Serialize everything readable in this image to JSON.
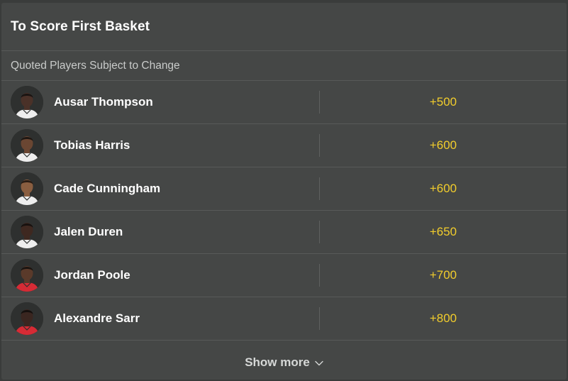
{
  "market": {
    "title": "To Score First Basket",
    "subtitle": "Quoted Players Subject to Change"
  },
  "players": [
    {
      "name": "Ausar Thompson",
      "odds": "+500",
      "skin": "#4a3128",
      "jersey": "#eeeeee",
      "hair": "#1a1412"
    },
    {
      "name": "Tobias Harris",
      "odds": "+600",
      "skin": "#6a4632",
      "jersey": "#eeeeee",
      "hair": "#1e1713"
    },
    {
      "name": "Cade Cunningham",
      "odds": "+600",
      "skin": "#8a5e40",
      "jersey": "#eeeeee",
      "hair": "#2a1d15"
    },
    {
      "name": "Jalen Duren",
      "odds": "+650",
      "skin": "#3e2820",
      "jersey": "#eeeeee",
      "hair": "#17110f"
    },
    {
      "name": "Jordan Poole",
      "odds": "+700",
      "skin": "#5a3a2a",
      "jersey": "#d62b35",
      "hair": "#1a1411"
    },
    {
      "name": "Alexandre Sarr",
      "odds": "+800",
      "skin": "#3a2620",
      "jersey": "#d62b35",
      "hair": "#15100e"
    }
  ],
  "footer": {
    "show_more_label": "Show more",
    "icon": "chevron-down-icon"
  },
  "colors": {
    "odds": "#f2cd2c",
    "panel": "#454746",
    "text": "#ffffff"
  }
}
